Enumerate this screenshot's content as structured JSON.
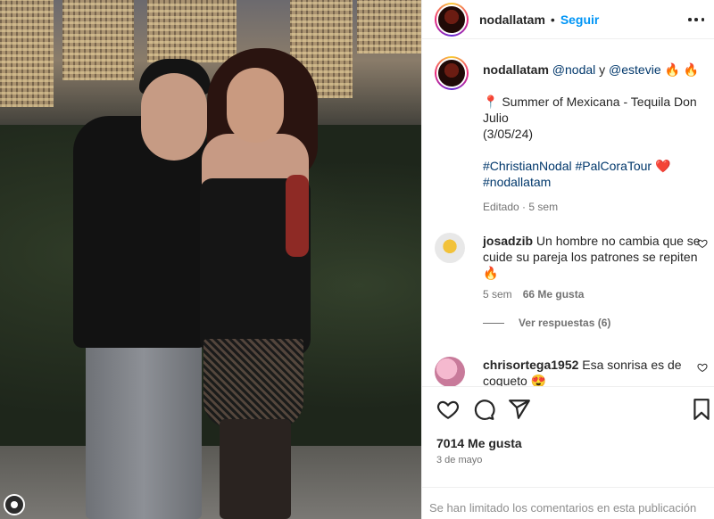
{
  "post": {
    "username": "nodallatam",
    "separator": "•",
    "follow_label": "Seguir",
    "mention_1": "@nodal",
    "conjunction": "y",
    "mention_2": "@estevie",
    "fire_emojis": "🔥 🔥",
    "pin_emoji": "📍",
    "caption_line_1": "Summer of Mexicana - Tequila Don Julio",
    "caption_line_2": "(3/05/24)",
    "hashtags": "#ChristianNodal #PalCoraTour",
    "heart_emoji": "❤️",
    "hashtag_2": "#nodallatam",
    "edited": "Editado",
    "edited_sep": "·",
    "edited_time": "5 sem",
    "likes": "7014 Me gusta",
    "date": "3 de mayo"
  },
  "comments": [
    {
      "username": "josadzib",
      "text": "Un hombre no cambia que se cuide su pareja los patrones se repiten",
      "emoji": "🔥",
      "time": "5 sem",
      "likes": "66 Me gusta",
      "replies": "Ver respuestas (6)"
    },
    {
      "username": "chrisortega1952",
      "text": "Esa sonrisa es de coqueto",
      "emoji": "😍"
    }
  ],
  "footer": {
    "notice": "Se han limitado los comentarios en esta publicación"
  },
  "icons": {
    "like": "heart-icon",
    "comment": "comment-icon",
    "share": "share-icon",
    "save": "bookmark-icon",
    "more": "more-icon"
  },
  "colors": {
    "follow": "#0095f6",
    "link": "#00376b",
    "muted": "#737373"
  }
}
